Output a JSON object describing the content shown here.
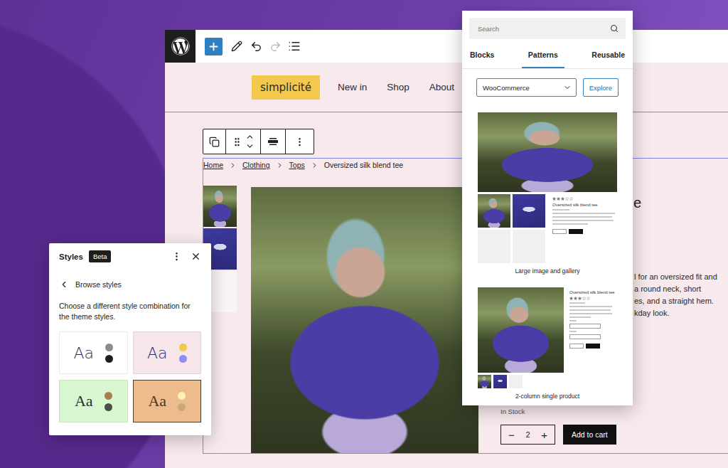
{
  "toolbar": {
    "redo_disabled": true
  },
  "site": {
    "logo": "simplicité",
    "nav": [
      {
        "label": "New in"
      },
      {
        "label": "Shop"
      },
      {
        "label": "About"
      }
    ]
  },
  "breadcrumb": [
    {
      "label": "Home",
      "current": false
    },
    {
      "label": "Clothing",
      "current": false
    },
    {
      "label": "Tops",
      "current": false
    },
    {
      "label": "Oversized silk blend tee",
      "current": true
    }
  ],
  "product": {
    "title_fragment": "e",
    "description_fragments": [
      "l for an oversized fit and",
      "a round neck, short",
      "es, and a straight hem.",
      "kday look."
    ],
    "stock": "In Stock",
    "quantity": "2",
    "decrease": "−",
    "increase": "+",
    "add_to_cart": "Add to cart"
  },
  "inserter": {
    "search_placeholder": "Search",
    "tabs": [
      {
        "label": "Blocks",
        "selected": false
      },
      {
        "label": "Patterns",
        "selected": true
      },
      {
        "label": "Reusable",
        "selected": false
      }
    ],
    "category": "WooCommerce",
    "explore": "Explore",
    "patterns": [
      {
        "name": "Large image and gallery",
        "kind": "gallery",
        "product_title": "Oversized silk blend tee",
        "stars": 3
      },
      {
        "name": "2-column single product",
        "kind": "two-column",
        "product_title": "Oversized silk blend tee",
        "stars": 3
      }
    ]
  },
  "styles": {
    "title": "Styles",
    "badge": "Beta",
    "back_label": "Browse styles",
    "description": "Choose a different style combination for the theme styles.",
    "variations": [
      {
        "sample": "Aa",
        "kind": "sans",
        "background": "#ffffff",
        "color": "#2c3553",
        "swatches": [
          "#8c8c8c",
          "#1e1e1e"
        ],
        "selected": false
      },
      {
        "sample": "Aa",
        "kind": "sans",
        "background": "#f6e6ea",
        "color": "#2a2f6e",
        "swatches": [
          "#f2c84b",
          "#8e8ef2"
        ],
        "selected": false
      },
      {
        "sample": "Aa",
        "kind": "serif",
        "background": "#d8f6cf",
        "color": "#2d2d2d",
        "swatches": [
          "#a97e47",
          "#4d4d4d"
        ],
        "selected": false
      },
      {
        "sample": "Aa",
        "kind": "serif",
        "background": "#eebc8c",
        "color": "#4a3420",
        "swatches": [
          "#fbf3b0",
          "#c9a779"
        ],
        "selected": true
      }
    ]
  }
}
